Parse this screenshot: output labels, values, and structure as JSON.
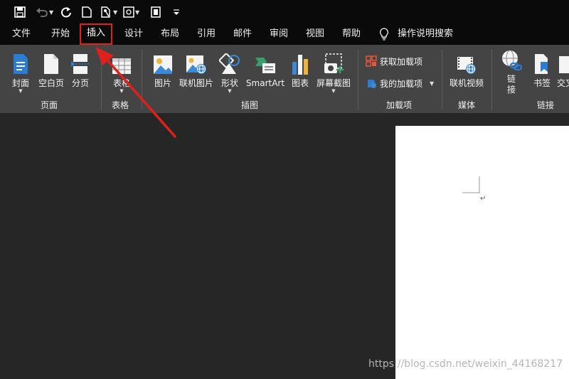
{
  "quick_access": {
    "icons": [
      "save-icon",
      "undo-icon",
      "redo-icon",
      "new-document-icon",
      "touch-mode-icon",
      "print-preview-icon",
      "page-icon",
      "customize-icon"
    ]
  },
  "tabs": [
    {
      "label": "文件"
    },
    {
      "label": "开始"
    },
    {
      "label": "插入",
      "active": true
    },
    {
      "label": "设计"
    },
    {
      "label": "布局"
    },
    {
      "label": "引用"
    },
    {
      "label": "邮件"
    },
    {
      "label": "审阅"
    },
    {
      "label": "视图"
    },
    {
      "label": "帮助"
    }
  ],
  "tell_me": {
    "label": "操作说明搜索"
  },
  "ribbon": {
    "pages": {
      "cover": "封面",
      "blank": "空白页",
      "break": "分页",
      "group": "页面"
    },
    "tables": {
      "table": "表格",
      "group": "表格"
    },
    "illustrations": {
      "picture": "图片",
      "online_picture": "联机图片",
      "shapes": "形状",
      "smartart": "SmartArt",
      "chart": "图表",
      "screenshot": "屏幕截图",
      "group": "插图"
    },
    "addins": {
      "get": "获取加载项",
      "mine": "我的加载项",
      "group": "加载项"
    },
    "media": {
      "video": "联机视频",
      "group": "媒体"
    },
    "links": {
      "link_a": "链",
      "link_b": "接",
      "bookmark": "书签",
      "xref": "交叉",
      "group": "链接"
    }
  },
  "document": {
    "paragraph_mark": "↵"
  },
  "watermark": "https://blog.csdn.net/weixin_44168217",
  "colors": {
    "highlight": "#e0201b",
    "ribbon": "#444444",
    "titlebar": "#0a0a0a",
    "workspace": "#262626"
  }
}
